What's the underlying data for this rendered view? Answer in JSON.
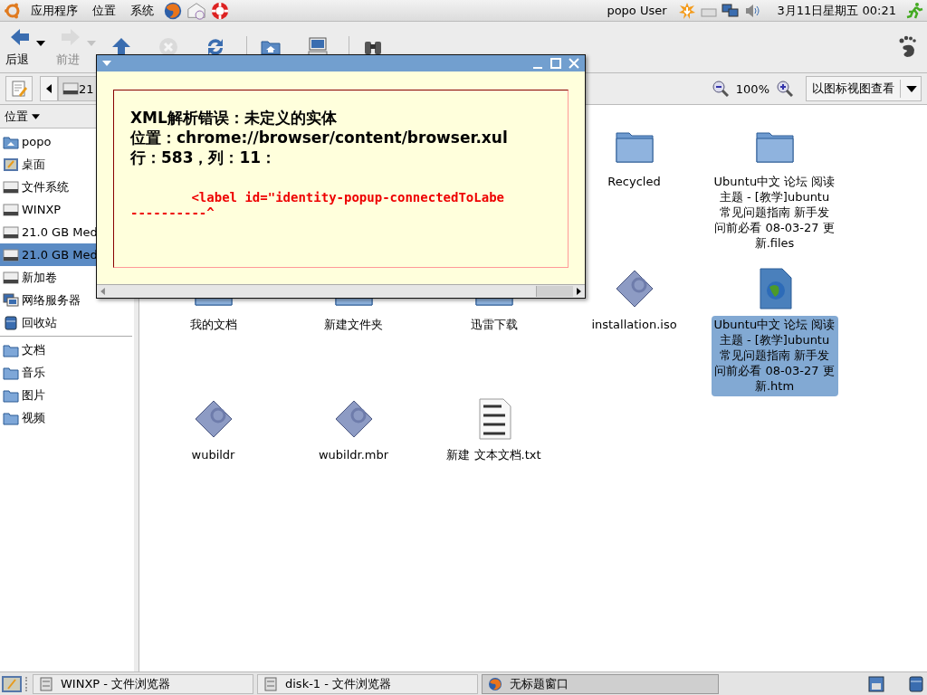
{
  "top_panel": {
    "menus": [
      "应用程序",
      "位置",
      "系统"
    ],
    "user": "popo User",
    "clock": "3月11日星期五  00:21"
  },
  "toolbar": [
    {
      "kind": "back",
      "label": "后退",
      "disabled": false,
      "dropdown": true
    },
    {
      "kind": "forward",
      "label": "前进",
      "disabled": true,
      "dropdown": true
    },
    {
      "kind": "up",
      "disabled": false
    },
    {
      "kind": "stop",
      "disabled": true
    },
    {
      "kind": "reload",
      "disabled": false
    },
    {
      "kind": "home",
      "disabled": false
    },
    {
      "kind": "computer",
      "disabled": false
    },
    {
      "kind": "search",
      "disabled": false
    }
  ],
  "location_bar": {
    "path_button": "21",
    "zoom": "100%",
    "view_mode": "以图标视图查看"
  },
  "sidebar": {
    "header": "位置",
    "places": [
      {
        "kind": "home",
        "label": "popo",
        "selected": false
      },
      {
        "kind": "desktop",
        "label": "桌面",
        "selected": false
      },
      {
        "kind": "drive",
        "label": "文件系统",
        "selected": false
      },
      {
        "kind": "drive",
        "label": "WINXP",
        "selected": false
      },
      {
        "kind": "drive",
        "label": "21.0 GB Med",
        "selected": false
      },
      {
        "kind": "drive",
        "label": "21.0 GB Med",
        "selected": true
      },
      {
        "kind": "drive",
        "label": "新加卷",
        "selected": false
      },
      {
        "kind": "network",
        "label": "网络服务器",
        "selected": false
      },
      {
        "kind": "trash",
        "label": "回收站",
        "selected": false
      }
    ],
    "bookmarks": [
      {
        "kind": "folder",
        "label": "文档",
        "selected": false
      },
      {
        "kind": "folder",
        "label": "音乐",
        "selected": false
      },
      {
        "kind": "folder",
        "label": "图片",
        "selected": false
      },
      {
        "kind": "folder",
        "label": "视频",
        "selected": false
      }
    ]
  },
  "files": [
    {
      "kind": "folder",
      "name": "Recycled",
      "selected": false
    },
    {
      "kind": "folder",
      "name": "Ubuntu中文  论坛   阅读主题 - [教学]ubuntu 常见问题指南 新手发问前必看  08-03-27 更新.files",
      "selected": false
    },
    {
      "kind": "folder",
      "name": "我的文档",
      "selected": false
    },
    {
      "kind": "folder",
      "name": "新建文件夹",
      "selected": false
    },
    {
      "kind": "folder",
      "name": "迅雷下载",
      "selected": false
    },
    {
      "kind": "package",
      "name": "installation.iso",
      "selected": false
    },
    {
      "kind": "web",
      "name": "Ubuntu中文  论坛   阅读主题 - [教学]ubuntu 常见问题指南 新手发问前必看  08-03-27 更新.htm",
      "selected": true
    },
    {
      "kind": "package",
      "name": "wubildr",
      "selected": false
    },
    {
      "kind": "package",
      "name": "wubildr.mbr",
      "selected": false
    },
    {
      "kind": "text",
      "name": "新建  文本文档.txt",
      "selected": false
    }
  ],
  "dialog": {
    "error_lines": [
      "XML解析错误：未定义的实体",
      "位置：chrome://browser/content/browser.xul",
      "行：583，列：11："
    ],
    "source_line": "        <label id=\"identity-popup-connectedToLabe",
    "pointer": "----------^"
  },
  "taskbar": [
    {
      "label": "WINXP - 文件浏览器",
      "kind": "files",
      "selected": false
    },
    {
      "label": "disk-1 - 文件浏览器",
      "kind": "files",
      "selected": false
    },
    {
      "label": "无标题窗口",
      "kind": "browser",
      "selected": true
    }
  ]
}
